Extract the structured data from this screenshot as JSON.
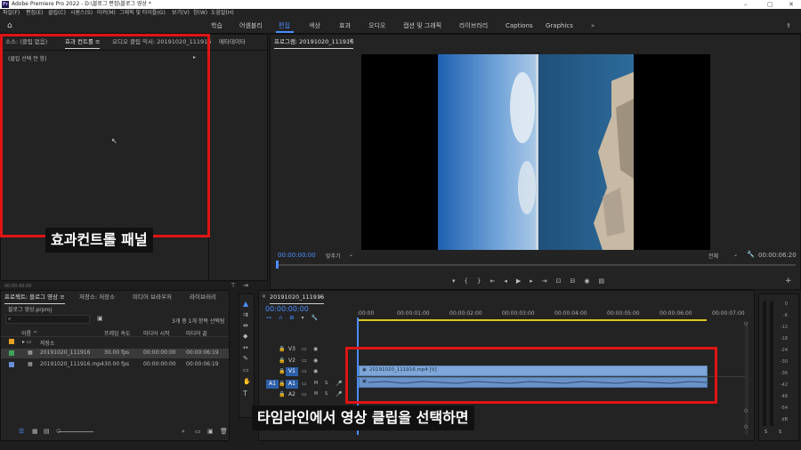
{
  "window": {
    "app_icon": "Pr",
    "title": "Adobe Premiere Pro 2022 - D:\\블로그 편집\\블로그 영상 *",
    "controls": [
      "–",
      "▢",
      "✕"
    ]
  },
  "menu": [
    "파일(F)",
    "편집(E)",
    "클립(C)",
    "시퀀스(S)",
    "마커(M)",
    "그래픽 및 타이틀(G)",
    "보기(V)",
    "창(W)",
    "도움말(H)"
  ],
  "workspaces": [
    "학습",
    "어셈블리",
    "편집",
    "색상",
    "효과",
    "오디오",
    "캡션 및 그래픽",
    "라이브러리",
    "Captions",
    "Graphics"
  ],
  "workspace_active": "편집",
  "workspace_more": "»",
  "effect_controls": {
    "tabs": [
      "소스: (클립 없음)",
      "효과 컨트롤 ≡",
      "오디오 클립 믹서: 20191020_111916",
      "메타데이터"
    ],
    "message": "(클립 선택 안 함)",
    "timecode": "00:00:00:00"
  },
  "program_monitor": {
    "title": "프로그램: 20191020_111916",
    "timecode": "00:00:00:00",
    "fit": "맞추기",
    "quality": "전체",
    "duration": "00:00:06:20"
  },
  "project": {
    "tabs": [
      "프로젝트: 블로그 영상 ≡",
      "미디어 브라우저",
      "라이브러리"
    ],
    "tab_bin": "저장소: 저장소",
    "file": "블로그 영상.prproj",
    "count": "3개 중 1개 항목 선택됨",
    "columns": [
      "이름 ^",
      "프레임 속도",
      "미디어 시작",
      "미디어 끝"
    ],
    "rows": [
      {
        "name": "저장소",
        "fps": "",
        "start": "",
        "end": ""
      },
      {
        "name": "20191020_111916",
        "fps": "30.00 fps",
        "start": "00:00:00:00",
        "end": "00:00:06:19"
      },
      {
        "name": "20191020_111916.mp4",
        "fps": "30.00 fps",
        "start": "00:00:00:00",
        "end": "00:00:06:19"
      }
    ]
  },
  "timeline": {
    "title": "20191020_111916",
    "timecode": "00:00:00:00",
    "ruler": [
      ":00:00",
      "00:00:01:00",
      "00:00:02:00",
      "00:00:03:00",
      "00:00:04:00",
      "00:00:05:00",
      "00:00:06:00",
      "00:00:07:00"
    ],
    "video_tracks": [
      "V3",
      "V2",
      "V1"
    ],
    "audio_tracks": [
      "A1",
      "A2"
    ],
    "mute": "M",
    "solo": "S",
    "clip_label": "20191020_111916.mp4 [V]"
  },
  "meters": {
    "labels": [
      "0",
      "-6",
      "-12",
      "-18",
      "-24",
      "-30",
      "-36",
      "-42",
      "-48",
      "-54",
      "dB"
    ],
    "solo": [
      "S",
      "S"
    ]
  },
  "annotations": {
    "effect_panel": "효과컨트롤 패널",
    "instruction": "타임라인에서 영상 클립을 선택하면"
  }
}
